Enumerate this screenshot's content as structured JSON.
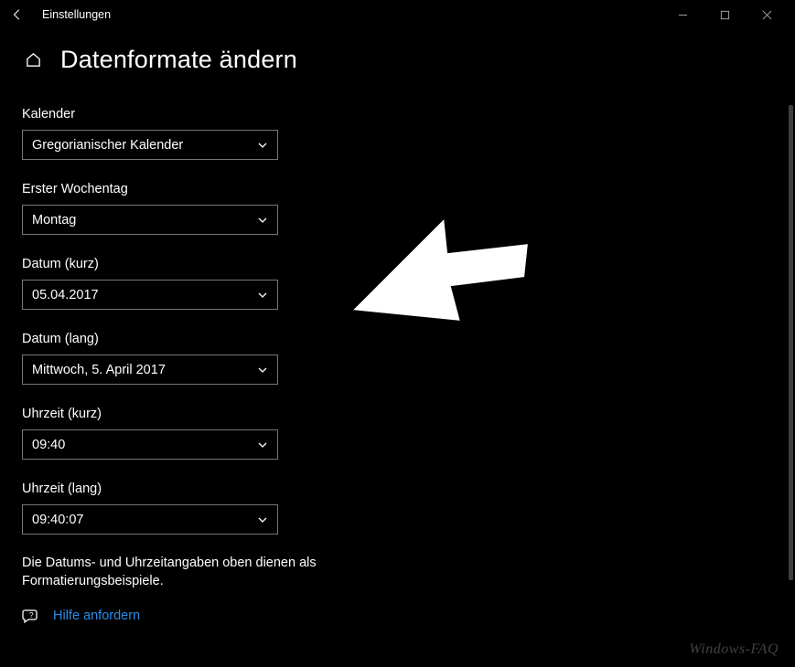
{
  "titlebar": {
    "title": "Einstellungen"
  },
  "header": {
    "page_title": "Datenformate ändern"
  },
  "fields": {
    "calendar": {
      "label": "Kalender",
      "value": "Gregorianischer Kalender"
    },
    "first_day": {
      "label": "Erster Wochentag",
      "value": "Montag"
    },
    "date_short": {
      "label": "Datum (kurz)",
      "value": "05.04.2017"
    },
    "date_long": {
      "label": "Datum (lang)",
      "value": "Mittwoch, 5. April 2017"
    },
    "time_short": {
      "label": "Uhrzeit (kurz)",
      "value": "09:40"
    },
    "time_long": {
      "label": "Uhrzeit (lang)",
      "value": "09:40:07"
    }
  },
  "hint": "Die Datums- und Uhrzeitangaben oben dienen als Formatierungsbeispiele.",
  "help": {
    "label": "Hilfe anfordern"
  },
  "watermark": "Windows-FAQ"
}
